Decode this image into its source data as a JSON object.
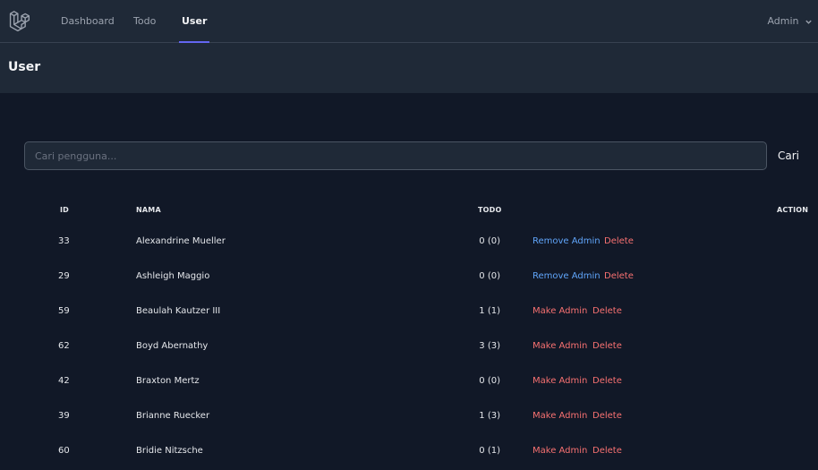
{
  "nav": {
    "links": [
      "Dashboard",
      "Todo",
      "User"
    ],
    "active": "User",
    "user_menu": "Admin"
  },
  "header": {
    "title": "User"
  },
  "search": {
    "placeholder": "Cari pengguna...",
    "button_label": "Cari"
  },
  "table": {
    "headers": {
      "id": "ID",
      "name": "NAMA",
      "todo": "TODO",
      "action": "ACTION"
    },
    "rows": [
      {
        "id": "33",
        "name": "Alexandrine Mueller",
        "todo": "0 (0)",
        "admin_action": "Remove Admin",
        "delete": "Delete"
      },
      {
        "id": "29",
        "name": "Ashleigh Maggio",
        "todo": "0 (0)",
        "admin_action": "Remove Admin",
        "delete": "Delete"
      },
      {
        "id": "59",
        "name": "Beaulah Kautzer III",
        "todo": "1 (1)",
        "admin_action": "Make Admin",
        "delete": "Delete"
      },
      {
        "id": "62",
        "name": "Boyd Abernathy",
        "todo": "3 (3)",
        "admin_action": "Make Admin",
        "delete": "Delete"
      },
      {
        "id": "42",
        "name": "Braxton Mertz",
        "todo": "0 (0)",
        "admin_action": "Make Admin",
        "delete": "Delete"
      },
      {
        "id": "39",
        "name": "Brianne Ruecker",
        "todo": "1 (3)",
        "admin_action": "Make Admin",
        "delete": "Delete"
      },
      {
        "id": "60",
        "name": "Bridie Nitzsche",
        "todo": "0 (1)",
        "admin_action": "Make Admin",
        "delete": "Delete"
      }
    ]
  },
  "colors": {
    "remove_admin": "#60a5fa",
    "make_admin": "#f87171",
    "delete": "#f87171",
    "accent": "#6366f1"
  }
}
